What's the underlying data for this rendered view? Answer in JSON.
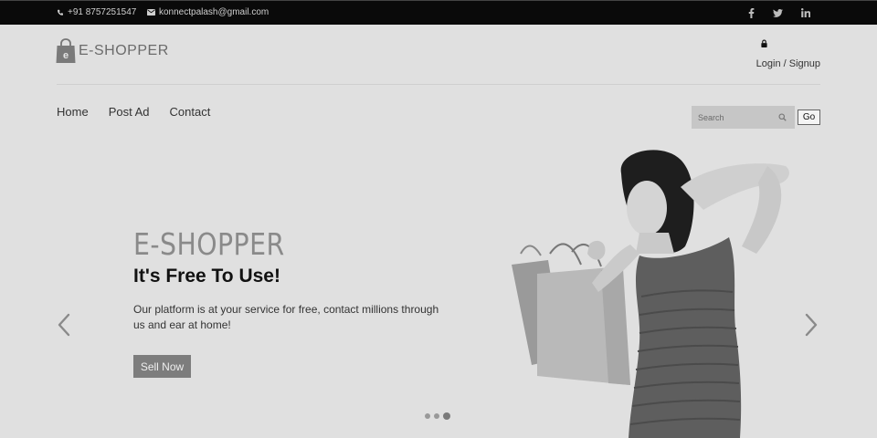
{
  "topbar": {
    "phone": "+91 8757251547",
    "email": "konnectpalash@gmail.com",
    "social": [
      "facebook-icon",
      "twitter-icon",
      "linkedin-icon"
    ]
  },
  "header": {
    "logo_letter": "e",
    "logo_text": "E-SHOPPER",
    "login_label": "Login / Signup"
  },
  "nav": {
    "items": [
      {
        "label": "Home"
      },
      {
        "label": "Post Ad"
      },
      {
        "label": "Contact"
      }
    ]
  },
  "search": {
    "placeholder": "Search",
    "value": "",
    "go_label": "Go"
  },
  "hero": {
    "brand": "E-SHOPPER",
    "title": "It's Free To Use!",
    "description": "Our platform is at your service for free, contact millions through us and ear at home!",
    "button_label": "Sell Now",
    "slide_count": 3,
    "active_slide": 3
  },
  "colors": {
    "topbar_bg": "#0a0a0a",
    "page_bg": "#e0e0e0",
    "button_bg": "#7d7d7d",
    "brand_text": "#8a8a8a"
  }
}
